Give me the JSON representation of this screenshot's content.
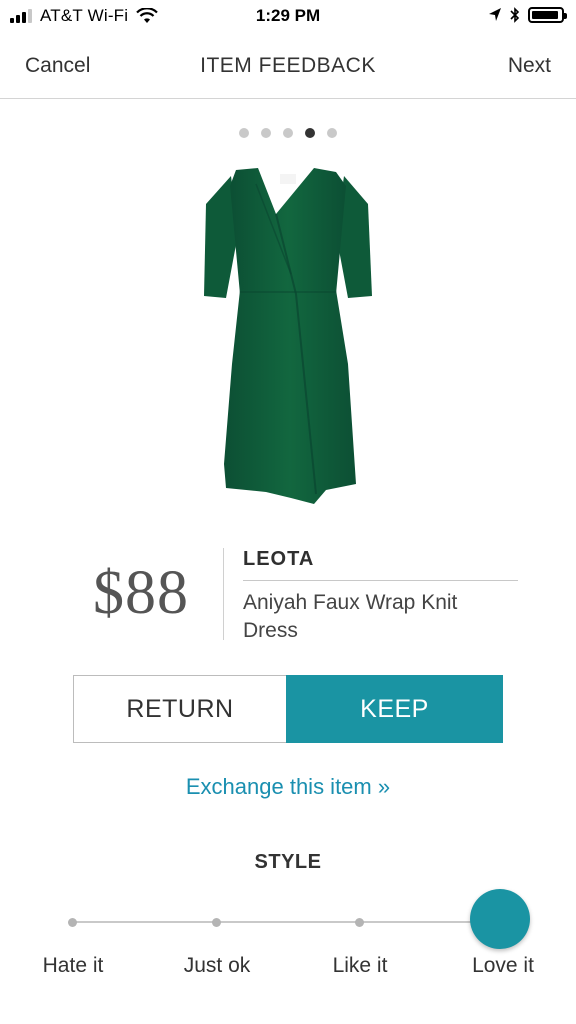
{
  "status_bar": {
    "carrier": "AT&T Wi-Fi",
    "time": "1:29 PM",
    "icons": [
      "signal-bars-icon",
      "wifi-icon",
      "location-arrow-icon",
      "bluetooth-icon",
      "battery-icon"
    ]
  },
  "nav": {
    "cancel_label": "Cancel",
    "title": "ITEM FEEDBACK",
    "next_label": "Next"
  },
  "pager": {
    "count": 5,
    "active_index": 3
  },
  "product": {
    "price": "$88",
    "brand": "LEOTA",
    "name": "Aniyah Faux Wrap Knit Dress",
    "image_color": "#0f5b3d"
  },
  "decision": {
    "return_label": "RETURN",
    "keep_label": "KEEP",
    "selected": "KEEP"
  },
  "exchange_link": "Exchange this item »",
  "style_rating": {
    "heading": "STYLE",
    "options": [
      "Hate it",
      "Just ok",
      "Like it",
      "Love it"
    ],
    "selected": "Love it"
  },
  "colors": {
    "accent": "#1a94a3",
    "link": "#1a8fb0"
  }
}
